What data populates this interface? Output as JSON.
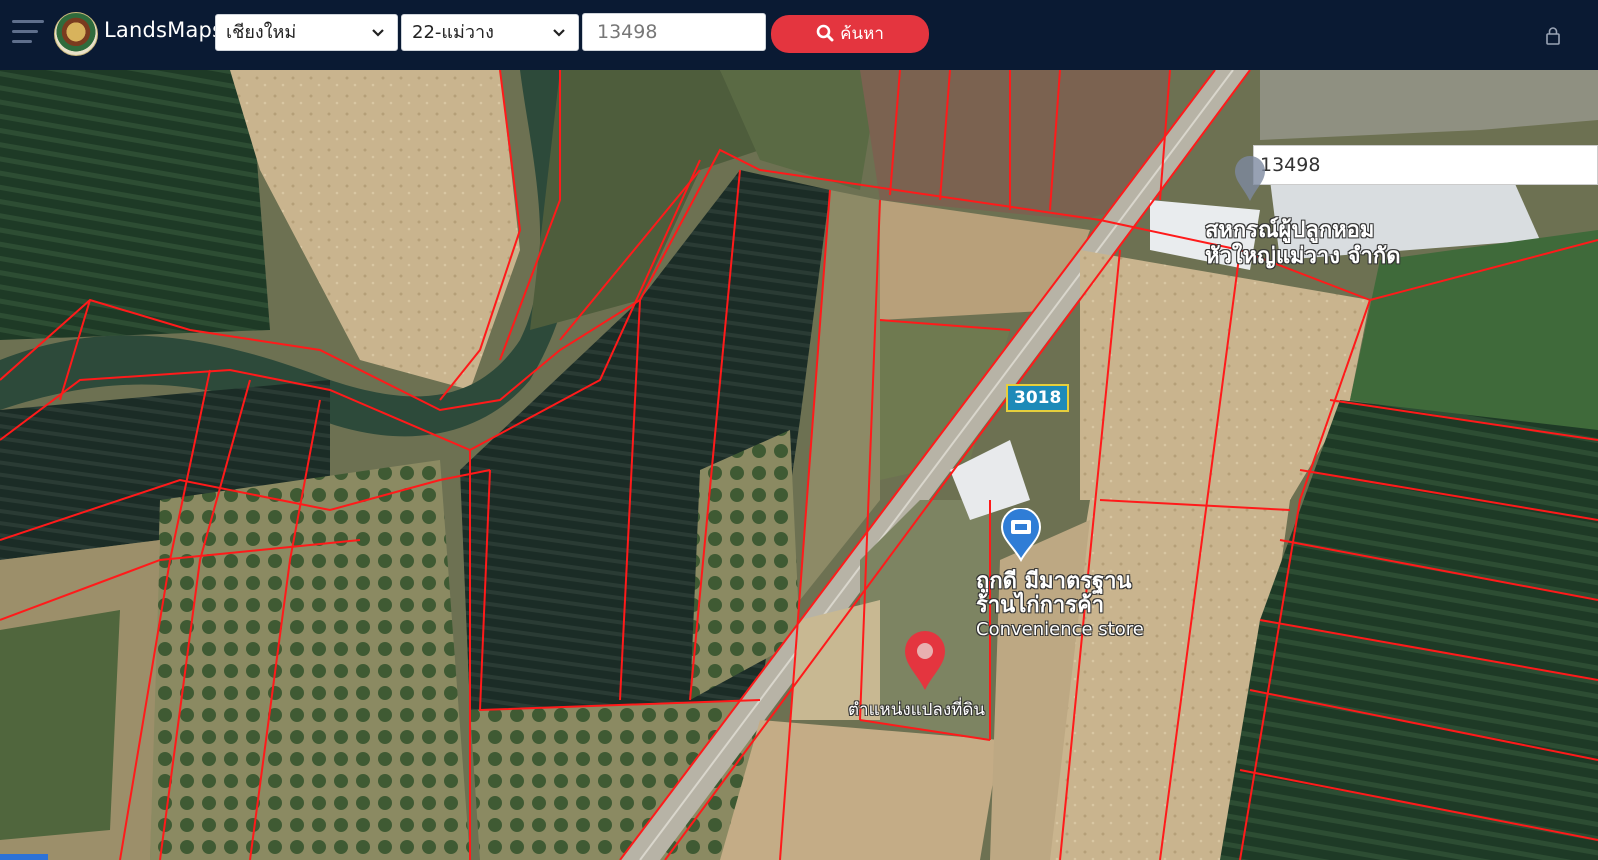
{
  "header": {
    "brand": "LandsMaps",
    "province": "เชียงใหม่",
    "district": "22-แม่วาง",
    "parcel_number": "13498",
    "search_label": "ค้นหา"
  },
  "map": {
    "search_value": "13498",
    "road_number": "3018",
    "poi_cooperative": [
      "สหกรณ์ผู้ปลูกหอม",
      "หัวใหญ่แม่วาง จำกัด"
    ],
    "poi_store": [
      "ถูกดี มีมาตรฐาน",
      "ร้านไก่การค้า",
      "Convenience store"
    ],
    "parcel_marker_label": "ตำแหน่งแปลงที่ดิน",
    "marker_color": "#e4353f",
    "parcel_line_color": "#ff1a1a"
  }
}
